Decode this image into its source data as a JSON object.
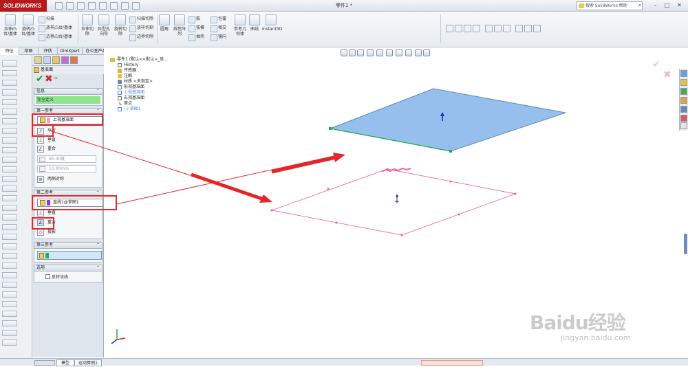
{
  "app": {
    "logo": "SOLIDWORKS",
    "document_title": "零件1 *"
  },
  "search": {
    "placeholder": "搜索 SolidWorks 帮助"
  },
  "window_controls": {
    "minimize": "–",
    "restore": "□",
    "close": "✕"
  },
  "command_manager": {
    "buttons": [
      {
        "label": "拉伸凸台/基体"
      },
      {
        "label": "旋转凸台/基体"
      },
      {
        "label": "扫描"
      },
      {
        "label": "放样凸台/基体"
      },
      {
        "label": "边界凸台/基体"
      },
      {
        "label": "拉伸切除"
      },
      {
        "label": "异型孔向导"
      },
      {
        "label": "旋转切除"
      },
      {
        "label": "扫描切除"
      },
      {
        "label": "放样切割"
      },
      {
        "label": "边界切除"
      },
      {
        "label": "圆角"
      },
      {
        "label": "线性阵列"
      },
      {
        "label": "筋"
      },
      {
        "label": "拔模"
      },
      {
        "label": "抽壳"
      },
      {
        "label": "包覆"
      },
      {
        "label": "相交"
      },
      {
        "label": "镜向"
      },
      {
        "label": "参考几何体"
      },
      {
        "label": "曲线"
      },
      {
        "label": "Instant3D"
      }
    ]
  },
  "command_tabs": [
    "特征",
    "草图",
    "评估",
    "DimXpert",
    "办公室产品"
  ],
  "property_manager": {
    "title": "基准面",
    "message_header": "信息",
    "message": "完全定义",
    "first_ref": {
      "header": "第一参考",
      "selection": "上视基准面",
      "options": [
        "平行",
        "垂直",
        "重合",
        "两侧对称"
      ],
      "angle": "90.00度",
      "distance": "10.00mm"
    },
    "second_ref": {
      "header": "第二参考",
      "selection": "直线1@草图1",
      "options": [
        "垂直",
        "重合",
        "投影"
      ]
    },
    "third_ref": {
      "header": "第三参考"
    },
    "options": {
      "header": "选项",
      "flip_normal": "反转法线"
    }
  },
  "feature_tree": {
    "root": "零件1 (默认<<默认>_显...",
    "items": [
      "History",
      "传感器",
      "注解",
      "材质 <未指定>",
      "前视基准面",
      "上视基准面",
      "右视基准面",
      "原点",
      "(-) 草图1"
    ]
  },
  "bottom_tabs": [
    "模型",
    "运动算例1"
  ],
  "watermark": {
    "brand": "Baidu经验",
    "url": "jingyan.baidu.com"
  },
  "colors": {
    "accent": "#e3262a",
    "plane_fill": "#8cb8ec",
    "sketch": "#e86aa8"
  }
}
